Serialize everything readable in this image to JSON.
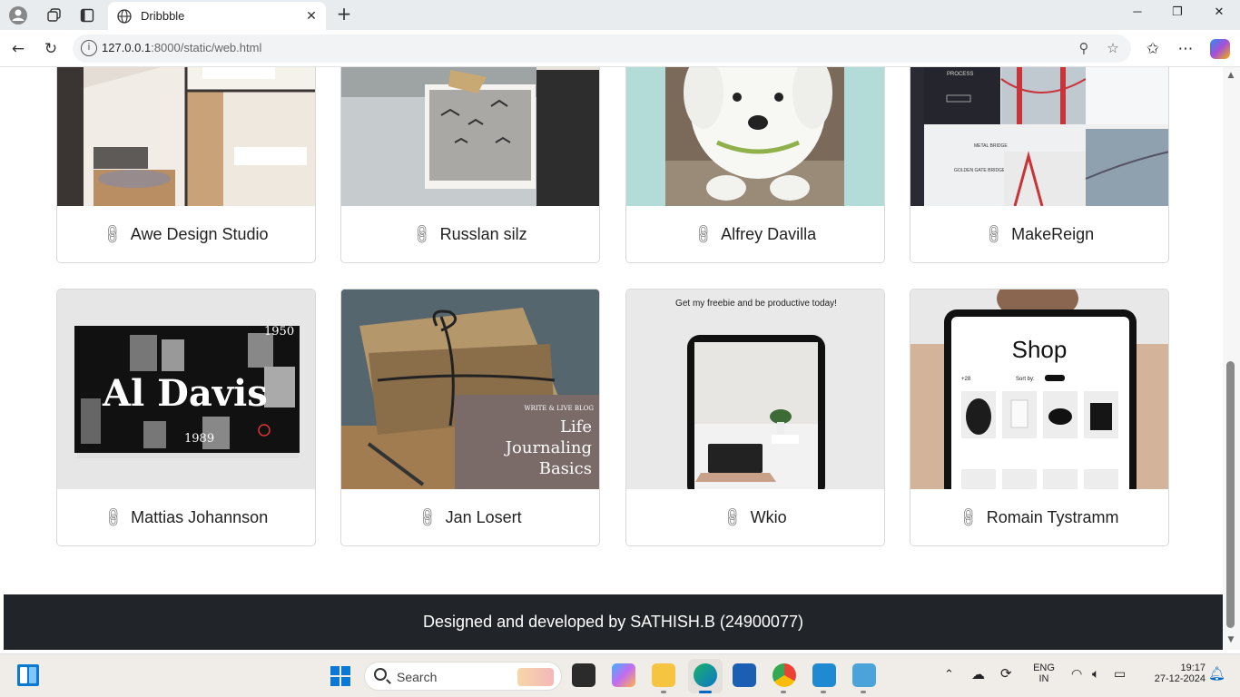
{
  "browser": {
    "tab_title": "Dribbble",
    "url_host": "127.0.0.1",
    "url_rest": ":8000/static/web.html"
  },
  "cards": [
    {
      "label": "Awe Design Studio",
      "icon": "link-icon"
    },
    {
      "label": "Russlan silz",
      "icon": "link-icon"
    },
    {
      "label": "Alfrey Davilla",
      "icon": "link-icon"
    },
    {
      "label": "MakeReign",
      "icon": "link-icon"
    },
    {
      "label": "Mattias Johannson",
      "icon": "link-icon"
    },
    {
      "label": "Jan Losert",
      "icon": "link-icon"
    },
    {
      "label": "Wkio",
      "icon": "link-icon"
    },
    {
      "label": "Romain Tystramm",
      "icon": "link-icon"
    }
  ],
  "thumb_text": {
    "aldavis_title": "Al Davis",
    "aldavis_year_top": "1950",
    "aldavis_year_bottom": "1989",
    "journal_small": "WRITE & LIVE BLOG",
    "journal_title_1": "Life",
    "journal_title_2": "Journaling",
    "journal_title_3": "Basics",
    "wkio_caption": "Get my freebie and be productive today!",
    "shop_title": "Shop",
    "shop_sort": "Sort by:",
    "shop_count": "+28",
    "makereign_label": "PROCESS",
    "makereign_label2": "METAL BRIDGE",
    "makereign_label3": "GOLDEN GATE BRIDGE"
  },
  "footer": {
    "credit": "Designed and developed by SATHISH.B (24900077)"
  },
  "taskbar": {
    "search_label": "Search",
    "lang_top": "ENG",
    "lang_bottom": "IN",
    "time": "19:17",
    "date": "27-12-2024"
  },
  "colors": {
    "footer_bg": "#212529",
    "accent": "#0067c0"
  }
}
